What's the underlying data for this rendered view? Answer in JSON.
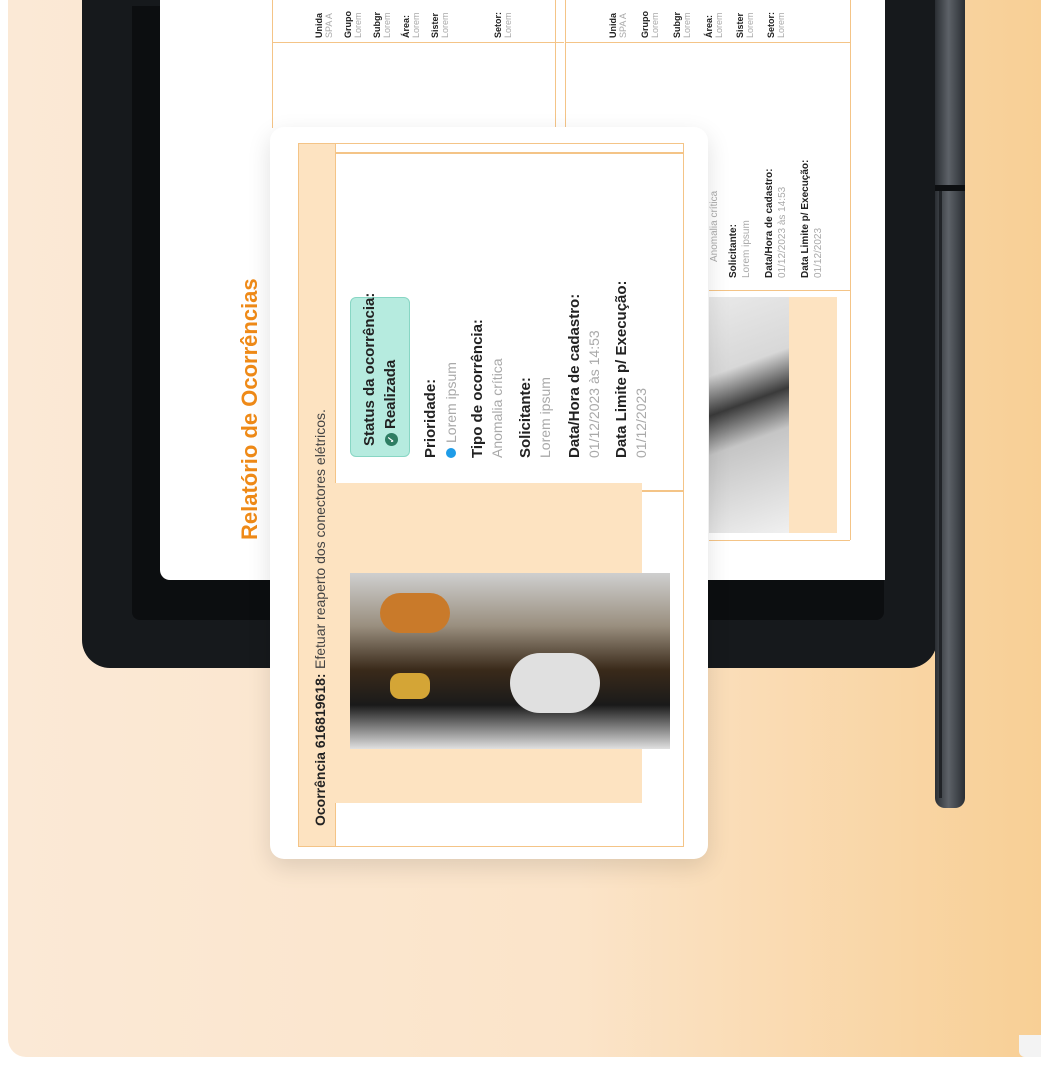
{
  "report": {
    "title": "Relatório de Ocorrências"
  },
  "mini_cards": [
    {
      "fields": [
        {
          "label": "Unida",
          "value": "SPA A"
        },
        {
          "label": "Grupo",
          "value": "Lorem"
        },
        {
          "label": "Subgr",
          "value": "Lorem"
        },
        {
          "label": "Área:",
          "value": "Lorem"
        },
        {
          "label": "Sister",
          "value": "Lorem"
        },
        {
          "label": "Setor:",
          "value": "Lorem"
        }
      ]
    },
    {
      "fields": [
        {
          "label": "Unida",
          "value": "SPA A"
        },
        {
          "label": "Grupo",
          "value": "Lorem"
        },
        {
          "label": "Subgr",
          "value": "Lorem"
        },
        {
          "label": "Área:",
          "value": "Lorem"
        },
        {
          "label": "Sister",
          "value": "Lorem"
        },
        {
          "label": "Setor:",
          "value": "Lorem"
        }
      ]
    }
  ],
  "right_card": {
    "tipo_value": "Anomalia crítica",
    "solicitante_label": "Solicitante:",
    "solicitante_value": "Lorem ipsum",
    "cadastro_label": "Data/Hora de cadastro:",
    "cadastro_value": "01/12/2023 às 14:53",
    "limite_label": "Data Limite p/ Execução:",
    "limite_value": "01/12/2023"
  },
  "occurrence": {
    "id_label": "Ocorrência 616819618:",
    "description": "Efetuar reaperto dos conectores elétricos.",
    "status_label": "Status da ocorrência:",
    "status_value": "Realizada",
    "prioridade_label": "Prioridade:",
    "prioridade_value": "Lorem ipsum",
    "tipo_label": "Tipo de ocorrência:",
    "tipo_value": "Anomalia crítica",
    "solicitante_label": "Solicitante:",
    "solicitante_value": "Lorem ipsum",
    "cadastro_label": "Data/Hora de cadastro:",
    "cadastro_value": "01/12/2023 às 14:53",
    "limite_label": "Data Limite p/ Execução:",
    "limite_value": "01/12/2023"
  },
  "colors": {
    "accent": "#ef8a17",
    "border": "#f4c487",
    "status_bg": "#b6ebdf",
    "priority_dot": "#1e9ce8"
  },
  "icons": [
    "check-circle-icon",
    "priority-dot-icon"
  ]
}
